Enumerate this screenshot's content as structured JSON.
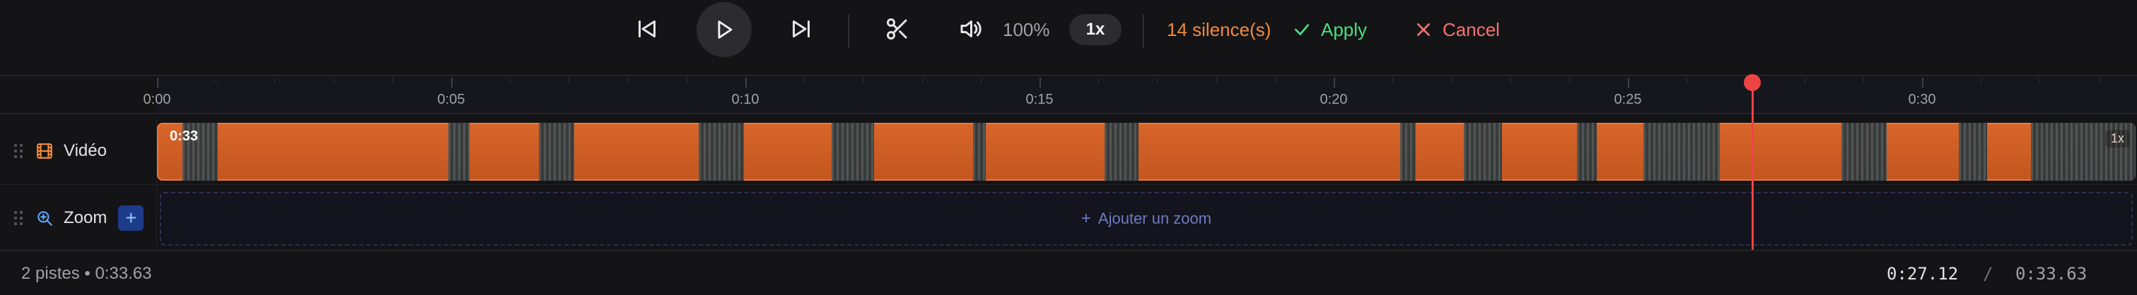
{
  "toolbar": {
    "icons": {
      "prev": "skip-back-icon",
      "play": "play-icon",
      "next": "skip-forward-icon",
      "cut": "scissors-icon",
      "volume": "volume-icon",
      "apply": "check-icon",
      "cancel": "x-icon"
    },
    "volume_percent": "100%",
    "speed": "1x",
    "silences_label": "14 silence(s)",
    "apply_label": "Apply",
    "cancel_label": "Cancel"
  },
  "ruler": {
    "ticks": [
      "0:00",
      "0:05",
      "0:10",
      "0:15",
      "0:20",
      "0:25",
      "0:30"
    ]
  },
  "tracks": {
    "video": {
      "label": "Vidéo",
      "icon": "film-icon",
      "clip_duration": "0:33",
      "clip_speed": "1x",
      "silence_count": 14
    },
    "zoom": {
      "label": "Zoom",
      "icon": "zoom-in-icon",
      "add_button": "+",
      "placeholder_plus": "+",
      "placeholder": "Ajouter un zoom"
    }
  },
  "playhead": {
    "time": "0:27.12"
  },
  "status": {
    "summary": "2 pistes • 0:33.63",
    "current_time": "0:27.12",
    "separator": "/",
    "total_time": "0:33.63"
  },
  "colors": {
    "accent_orange": "#d9652a",
    "silence_count": "#f08a3c",
    "apply_green": "#4ade80",
    "cancel_red": "#f87171",
    "playhead_red": "#ef4444",
    "zoom_button_blue": "#1e3a8a"
  }
}
